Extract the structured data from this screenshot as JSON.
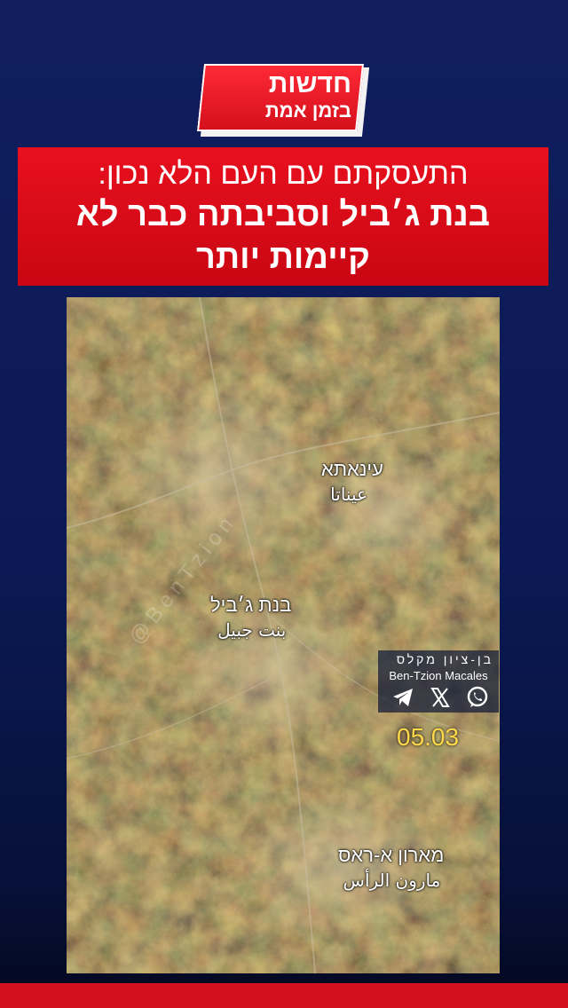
{
  "logo": {
    "line1": "חדשות",
    "line2": "בזמן אמת"
  },
  "headline": {
    "line1": "התעסקתם עם העם הלא נכון:",
    "line2": "בנת ג׳ביל וסביבתה כבר לא",
    "line3": "קיימות יותר"
  },
  "map": {
    "places": [
      {
        "he": "עינאתא",
        "ar": "عيناتا"
      },
      {
        "he": "בנת ג׳ביל",
        "ar": "بنت جبيل"
      },
      {
        "he": "מארון א-ראס",
        "ar": "مارون الرأس"
      }
    ],
    "watermark": "@BenTzion"
  },
  "credit": {
    "hebrew_name": "בן-ציון מקלס",
    "english_name": "Ben-Tzion Macales",
    "icons": [
      "telegram-icon",
      "x-icon",
      "whatsapp-icon"
    ]
  },
  "date": "05.03",
  "colors": {
    "brand_red": "#d40f1c",
    "background_blue": "#0b1a55",
    "date_yellow": "#ffd84a"
  }
}
